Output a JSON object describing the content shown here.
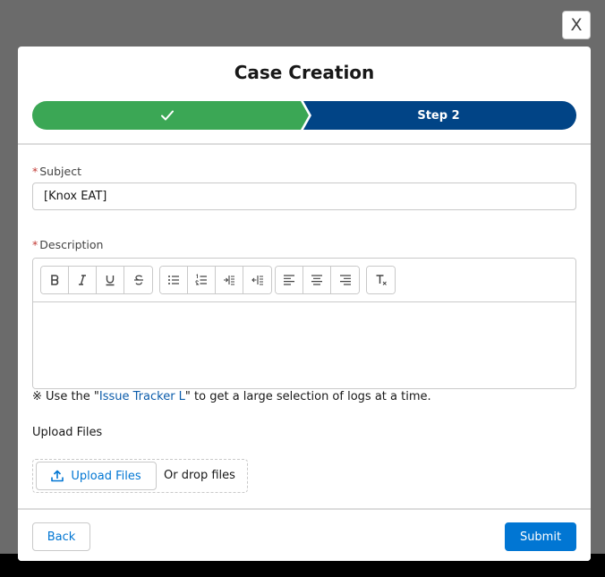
{
  "close_label": "X",
  "modal": {
    "title": "Case Creation",
    "steps": [
      {
        "label": "",
        "state": "complete",
        "color": "#3ba755"
      },
      {
        "label": "Step 2",
        "state": "current",
        "color": "#014486"
      }
    ]
  },
  "form": {
    "subject": {
      "required_mark": "*",
      "label": "Subject",
      "value": "[Knox EAT]"
    },
    "description": {
      "required_mark": "*",
      "label": "Description",
      "toolbar_icons": [
        "bold-icon",
        "italic-icon",
        "underline-icon",
        "strikethrough-icon",
        "bullet-list-icon",
        "numbered-list-icon",
        "indent-icon",
        "outdent-icon",
        "align-left-icon",
        "align-center-icon",
        "align-right-icon",
        "clear-format-icon"
      ]
    },
    "hint": {
      "prefix": "※ Use the \"",
      "link": "Issue Tracker L",
      "suffix": "\" to get a large selection of logs at a time."
    },
    "upload": {
      "label": "Upload Files",
      "button_label": "Upload Files",
      "drop_text": "Or drop files"
    }
  },
  "footer": {
    "back_label": "Back",
    "submit_label": "Submit"
  },
  "colors": {
    "brand": "#0176d3",
    "step_complete": "#3ba755",
    "step_current": "#014486",
    "required": "#c23934"
  }
}
